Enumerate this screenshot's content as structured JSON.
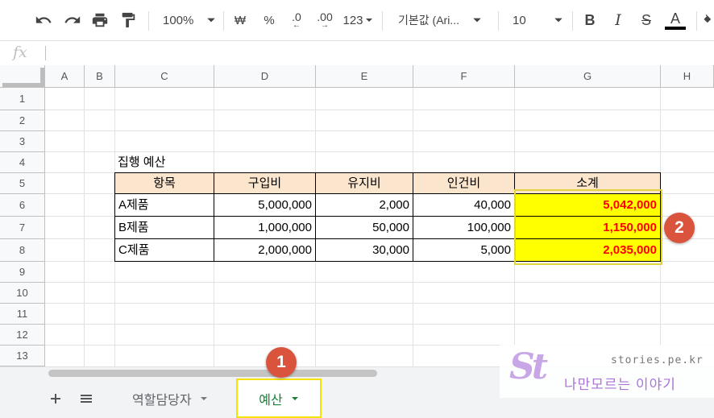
{
  "toolbar": {
    "zoom": "100%",
    "currency": "₩",
    "percent": "%",
    "decimal_decrease": ".0",
    "decimal_increase": ".00",
    "format_more": "123",
    "font": "기본값 (Ari...",
    "font_size": "10",
    "bold": "B",
    "italic": "I",
    "strike": "S",
    "text_color": "A"
  },
  "formula_bar": {
    "fx": "fx",
    "value": ""
  },
  "columns": [
    "A",
    "B",
    "C",
    "D",
    "E",
    "F",
    "G",
    "H"
  ],
  "rows": [
    "1",
    "2",
    "3",
    "4",
    "5",
    "6",
    "7",
    "8",
    "9",
    "10",
    "11",
    "12",
    "13"
  ],
  "table": {
    "title": "집행 예산",
    "headers": [
      "항목",
      "구입비",
      "유지비",
      "인건비",
      "소계"
    ],
    "rows": [
      {
        "item": "A제품",
        "purchase": "5,000,000",
        "maintenance": "2,000",
        "labor": "40,000",
        "subtotal": "5,042,000"
      },
      {
        "item": "B제품",
        "purchase": "1,000,000",
        "maintenance": "50,000",
        "labor": "100,000",
        "subtotal": "1,150,000"
      },
      {
        "item": "C제품",
        "purchase": "2,000,000",
        "maintenance": "30,000",
        "labor": "5,000",
        "subtotal": "2,035,000"
      }
    ]
  },
  "callouts": [
    "1",
    "2"
  ],
  "sheets": [
    {
      "name": "역할담당자",
      "active": false
    },
    {
      "name": "예산",
      "active": true
    }
  ],
  "watermark": {
    "site": "stories.pe.kr",
    "tagline": "나만모르는 이야기",
    "mark": "St"
  },
  "colors": {
    "header_fill": "#fce5cd",
    "total_fill": "#ffff00",
    "total_text": "#ff0000",
    "active_tab": "#188038",
    "callout": "#d9533d"
  }
}
